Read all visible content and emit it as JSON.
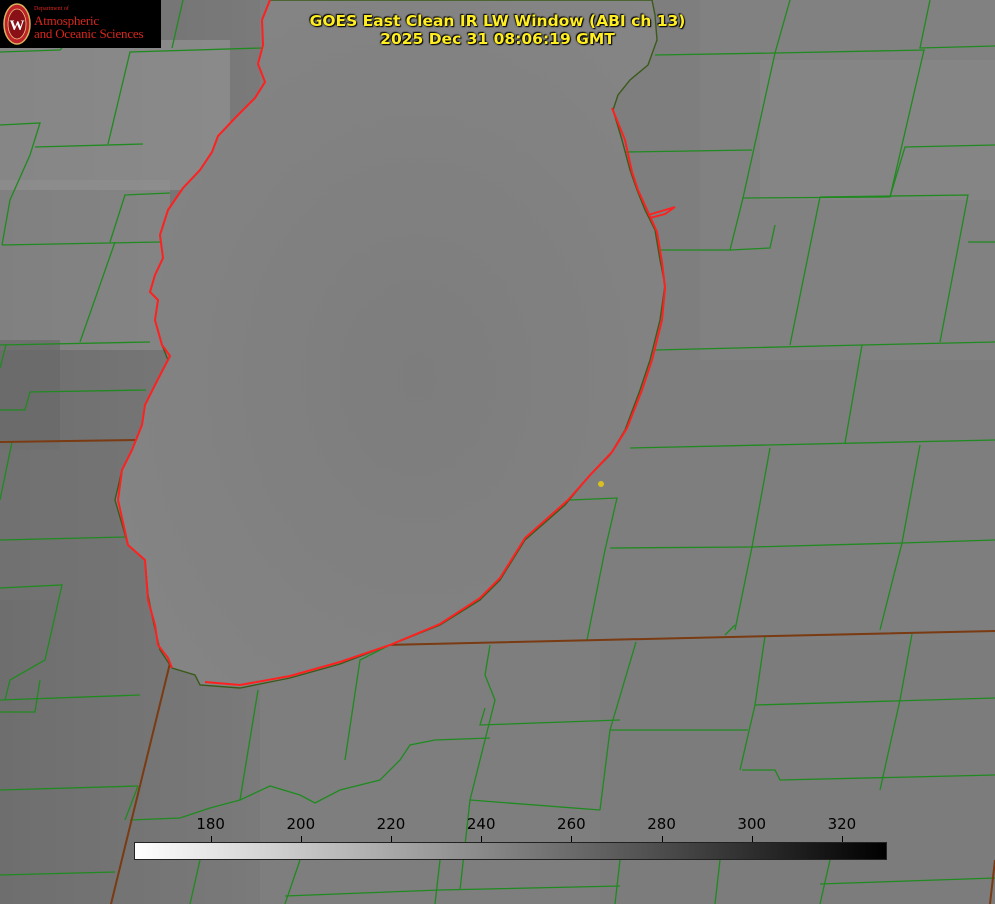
{
  "title": {
    "line1": "GOES East Clean IR LW Window (ABI ch 13)",
    "line2": "2025 Dec 31 08:06:19 GMT"
  },
  "logo": {
    "department": "Department of",
    "line1": "Atmospheric",
    "line2": "and Oceanic Sciences",
    "seal_letter": "W"
  },
  "colorbar": {
    "ticks": [
      "180",
      "200",
      "220",
      "240",
      "260",
      "280",
      "300",
      "320"
    ],
    "tick_values": [
      180,
      200,
      220,
      240,
      260,
      280,
      300,
      320
    ],
    "range": [
      163,
      330
    ],
    "gradient": [
      "#ffffff",
      "#000000"
    ]
  },
  "colors": {
    "county_lines": "#1f8a1f",
    "state_lines": "#7a3a12",
    "lake_shoreline": "#ff2020",
    "title_text": "#ffee22",
    "marker": "#d8c020"
  },
  "features": {
    "lake": "Lake Michigan",
    "marker": "yellow-dot"
  }
}
